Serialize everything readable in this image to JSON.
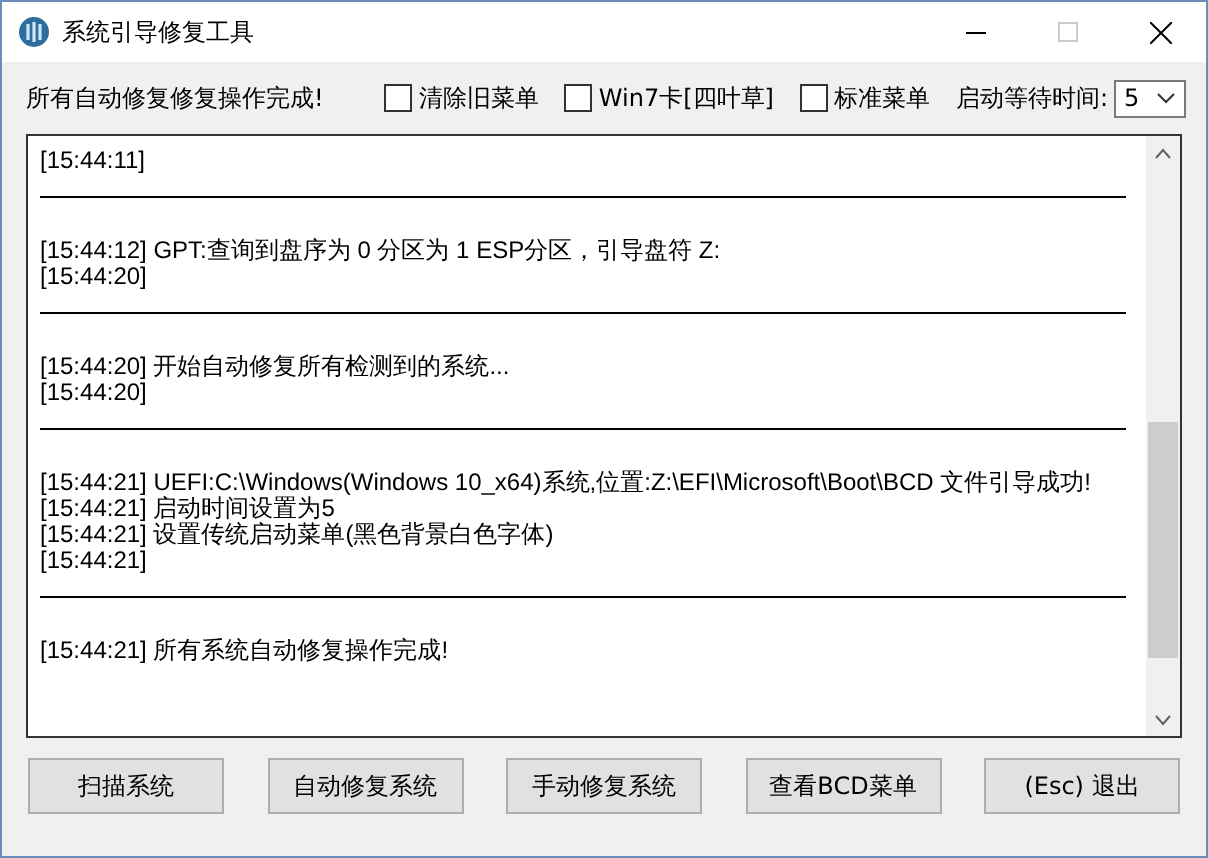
{
  "window": {
    "title": "系统引导修复工具"
  },
  "status": "所有自动修复修复操作完成!",
  "options": [
    {
      "label": "清除旧菜单",
      "checked": false
    },
    {
      "label": "Win7卡[四叶草]",
      "checked": false
    },
    {
      "label": "标准菜单",
      "checked": false
    }
  ],
  "wait_time": {
    "label": "启动等待时间:",
    "value": "5"
  },
  "log": [
    {
      "lines": [
        "[15:44:11]"
      ]
    },
    {
      "lines": [
        "[15:44:12] GPT:查询到盘序为 0 分区为 1 ESP分区，引导盘符 Z:",
        "[15:44:20]"
      ]
    },
    {
      "lines": [
        "[15:44:20] 开始自动修复所有检测到的系统...",
        "[15:44:20]"
      ]
    },
    {
      "lines": [
        "[15:44:21] UEFI:C:\\Windows(Windows 10_x64)系统,位置:Z:\\EFI\\Microsoft\\Boot\\BCD 文件引导成功!",
        "[15:44:21] 启动时间设置为5",
        "[15:44:21] 设置传统启动菜单(黑色背景白色字体)",
        "[15:44:21]"
      ]
    },
    {
      "lines": [
        "[15:44:21] 所有系统自动修复操作完成!"
      ]
    }
  ],
  "buttons": [
    "扫描系统",
    "自动修复系统",
    "手动修复系统",
    "查看BCD菜单",
    "(Esc) 退出"
  ]
}
